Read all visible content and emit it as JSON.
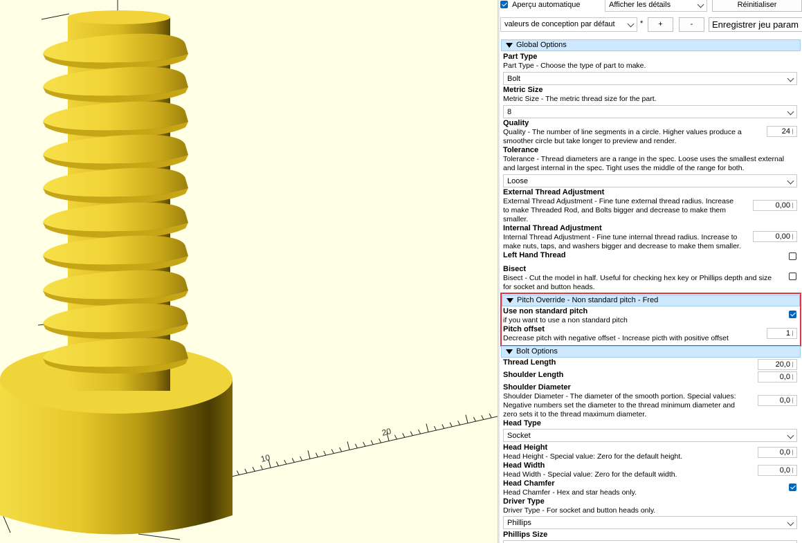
{
  "toolbar": {
    "auto_preview_label": "Aperçu automatique",
    "auto_preview_checked": true,
    "details_select": "Afficher les détails",
    "reset_button": "Réinitialiser",
    "preset_select": "valeurs de conception par défaut",
    "modified_marker": "*",
    "add_button": "+",
    "remove_button": "-",
    "save_button": "Enregistrer jeu param"
  },
  "viewport": {
    "axis_tick_10": "10",
    "axis_tick_20": "20"
  },
  "sections": {
    "global": "Global Options",
    "pitch": "Pitch Override - Non standard pitch - Fred",
    "bolt": "Bolt Options"
  },
  "params": {
    "part_type": {
      "name": "Part Type",
      "desc": "Part Type - Choose the type of part to make.",
      "value": "Bolt"
    },
    "metric_size": {
      "name": "Metric Size",
      "desc": "Metric Size - The metric thread size for the part.",
      "value": "8"
    },
    "quality": {
      "name": "Quality",
      "desc1": "Quality - The number of line segments in a circle. Higher values produce a",
      "desc2": "smoother circle but take longer to preview and render.",
      "value": "24"
    },
    "tolerance": {
      "name": "Tolerance",
      "desc1": "Tolerance - Thread diameters are a range in the spec. Loose uses the smallest external",
      "desc2": "and largest internal in the spec. Tight uses the middle of the range for both.",
      "value": "Loose"
    },
    "ext_thread": {
      "name": "External Thread Adjustment",
      "desc1": "External Thread Adjustment - Fine tune external thread radius. Increase",
      "desc2": "to make Threaded Rod, and Bolts bigger and decrease to make them",
      "desc3": "smaller.",
      "value": "0,00"
    },
    "int_thread": {
      "name": "Internal Thread Adjustment",
      "desc1": "Internal Thread Adjustment - Fine tune internal thread radius. Increase to",
      "desc2": "make nuts, taps, and washers bigger and decrease to make them smaller.",
      "value": "0,00"
    },
    "left_hand": {
      "name": "Left Hand Thread",
      "checked": false
    },
    "bisect": {
      "name": "Bisect",
      "desc1": "Bisect - Cut the model in half. Useful for checking hex key or Phillips depth and size",
      "desc2": "for socket and button heads.",
      "checked": false
    },
    "use_nonstd": {
      "name": "Use non standard pitch",
      "desc": "if you want to use a non standard pitch",
      "checked": true
    },
    "pitch_offset": {
      "name": "Pitch offset",
      "desc": "Decrease pitch with negative offset - Increase picth with positive offset",
      "value": "1"
    },
    "thread_length": {
      "name": "Thread Length",
      "value": "20,0"
    },
    "shoulder_length": {
      "name": "Shoulder Length",
      "value": "0,0"
    },
    "shoulder_diameter": {
      "name": "Shoulder Diameter",
      "desc1": "Shoulder Diameter - The diameter of the smooth portion. Special values:",
      "desc2": "Negative numbers set the diameter to the thread minimum diameter and",
      "desc3": "zero sets it to the thread maximum diameter.",
      "value": "0,0"
    },
    "head_type": {
      "name": "Head Type",
      "value": "Socket"
    },
    "head_height": {
      "name": "Head Height",
      "desc": "Head Height - Special value: Zero for the default height.",
      "value": "0,0"
    },
    "head_width": {
      "name": "Head Width",
      "desc": "Head Width - Special value: Zero for the default width.",
      "value": "0,0"
    },
    "head_chamfer": {
      "name": "Head Chamfer",
      "desc": "Head Chamfer - Hex and star heads only.",
      "checked": true
    },
    "driver_type": {
      "name": "Driver Type",
      "desc": "Driver Type - For socket and button heads only.",
      "value": "Phillips"
    },
    "phillips_size": {
      "name": "Phillips Size"
    }
  },
  "colors": {
    "viewport_bg": "#ffffe5",
    "model_yellow": "#f2d43a",
    "section_bg": "#cde8ff",
    "highlight": "#e0353b",
    "checkbox_on": "#0067c0"
  }
}
